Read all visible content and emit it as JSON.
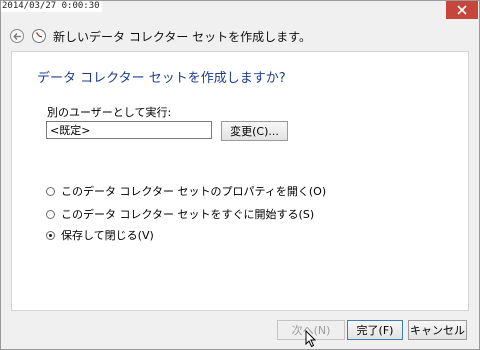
{
  "timestamp": "2014/03/27 0:00:30",
  "header": {
    "title": "新しいデータ コレクター セットを作成します。"
  },
  "content": {
    "heading": "データ コレクター セットを作成しますか?",
    "runas_label": "別のユーザーとして実行:",
    "runas_value": "<既定>",
    "change_button": "変更(C)...",
    "options": [
      {
        "label": "このデータ コレクター セットのプロパティを開く(O)",
        "checked": false
      },
      {
        "label": "このデータ コレクター セットをすぐに開始する(S)",
        "checked": false
      },
      {
        "label": "保存して閉じる(V)",
        "checked": true
      }
    ]
  },
  "footer": {
    "next": "次へ(N)",
    "finish": "完了(F)",
    "cancel": "キャンセル"
  },
  "colors": {
    "heading": "#1e3d8f",
    "close_button": "#c7463b"
  },
  "icons": [
    "close-icon",
    "back-arrow-icon",
    "wizard-icon",
    "mouse-cursor-icon"
  ]
}
